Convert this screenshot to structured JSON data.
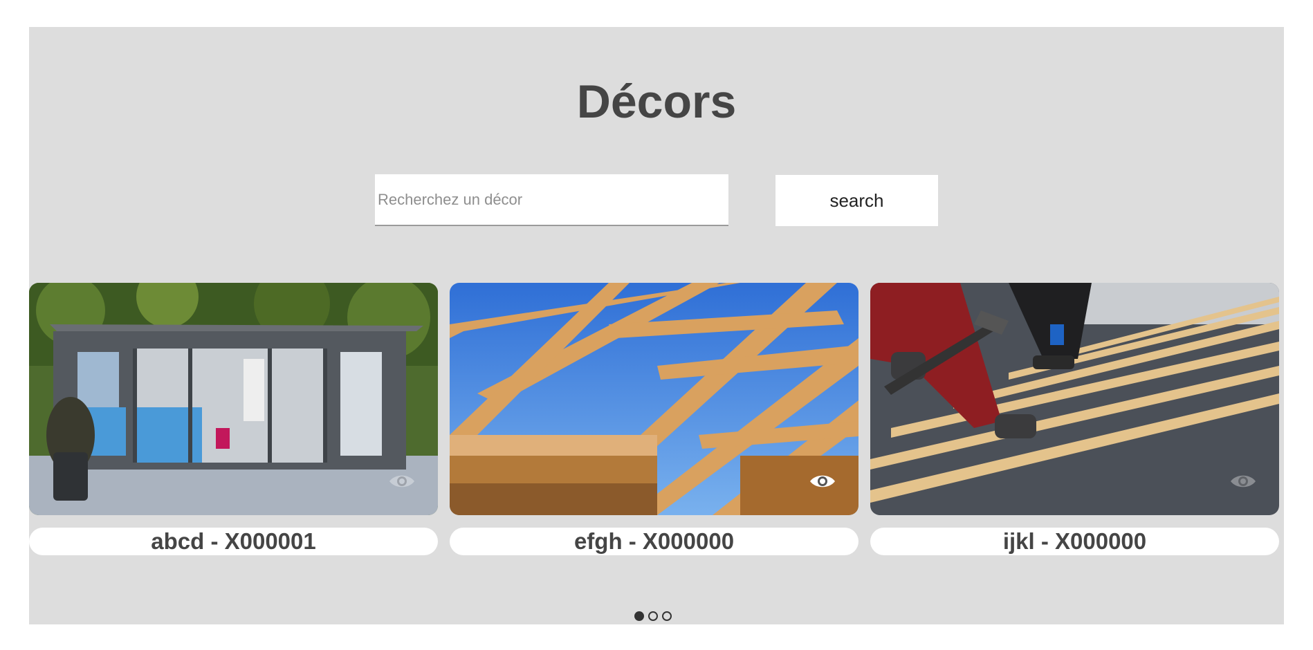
{
  "page": {
    "title": "Décors"
  },
  "search": {
    "placeholder": "Recherchez un décor",
    "value": "",
    "button_label": "search"
  },
  "carousel": {
    "cards": [
      {
        "label": "abcd - X000001",
        "image": "garden-room-photo",
        "icon": "eye-icon"
      },
      {
        "label": "efgh - X000000",
        "image": "roof-framing-photo",
        "icon": "eye-icon"
      },
      {
        "label": "ijkl - X000000",
        "image": "roof-battens-photo",
        "icon": "eye-icon"
      }
    ],
    "pagination": {
      "count": 3,
      "active_index": 0
    }
  },
  "colors": {
    "panel_bg": "#dddddd",
    "title": "#454545",
    "label_text": "#454545",
    "dot": "#333333"
  }
}
